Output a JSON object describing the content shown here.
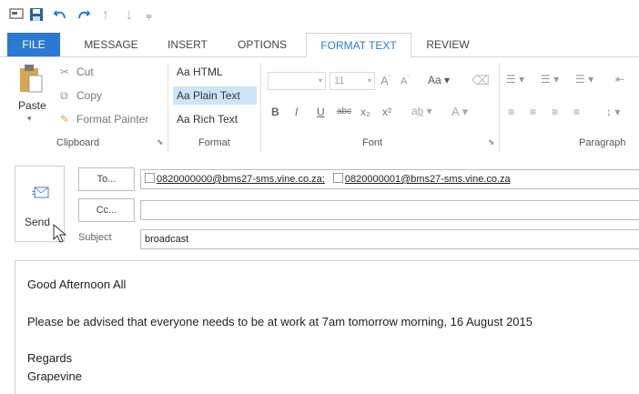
{
  "qat": {
    "icons": [
      "message-icon",
      "save-icon",
      "undo-icon",
      "redo-icon",
      "up-arrow-icon",
      "down-arrow-icon",
      "customize-icon"
    ]
  },
  "tabs": [
    {
      "label": "FILE"
    },
    {
      "label": "MESSAGE"
    },
    {
      "label": "INSERT"
    },
    {
      "label": "OPTIONS"
    },
    {
      "label": "FORMAT TEXT"
    },
    {
      "label": "REVIEW"
    }
  ],
  "ribbon": {
    "clipboard": {
      "paste": "Paste",
      "cut": "Cut",
      "copy": "Copy",
      "format_painter": "Format Painter",
      "group": "Clipboard"
    },
    "format": {
      "html": "Aa HTML",
      "plain": "Aa Plain Text",
      "rich": "Aa Rich Text",
      "group": "Format",
      "selected": "Plain Text"
    },
    "font": {
      "size": "11",
      "case": "Aa",
      "bold": "B",
      "italic": "I",
      "underline": "U",
      "strike": "abc",
      "sub": "x₂",
      "sup": "x²",
      "color": "A",
      "group": "Font"
    },
    "paragraph": {
      "group": "Paragraph"
    }
  },
  "compose": {
    "send": "Send",
    "to_button": "To...",
    "cc_button": "Cc...",
    "subject_label": "Subject",
    "to_recipients": [
      "0820000000@bms27-sms.vine.co.za;",
      "0820000001@bms27-sms.vine.co.za"
    ],
    "cc_value": "",
    "subject_value": "broadcast"
  },
  "body": {
    "greeting": "Good Afternoon All",
    "message": "Please be advised that everyone needs to be at work at 7am tomorrow morning, 16 August 2015",
    "closing": "Regards",
    "signature": "Grapevine"
  },
  "colors": {
    "file_tab": "#2b79d0",
    "active_tab_text": "#2b79d0",
    "selected_format": "#cde6f7"
  }
}
